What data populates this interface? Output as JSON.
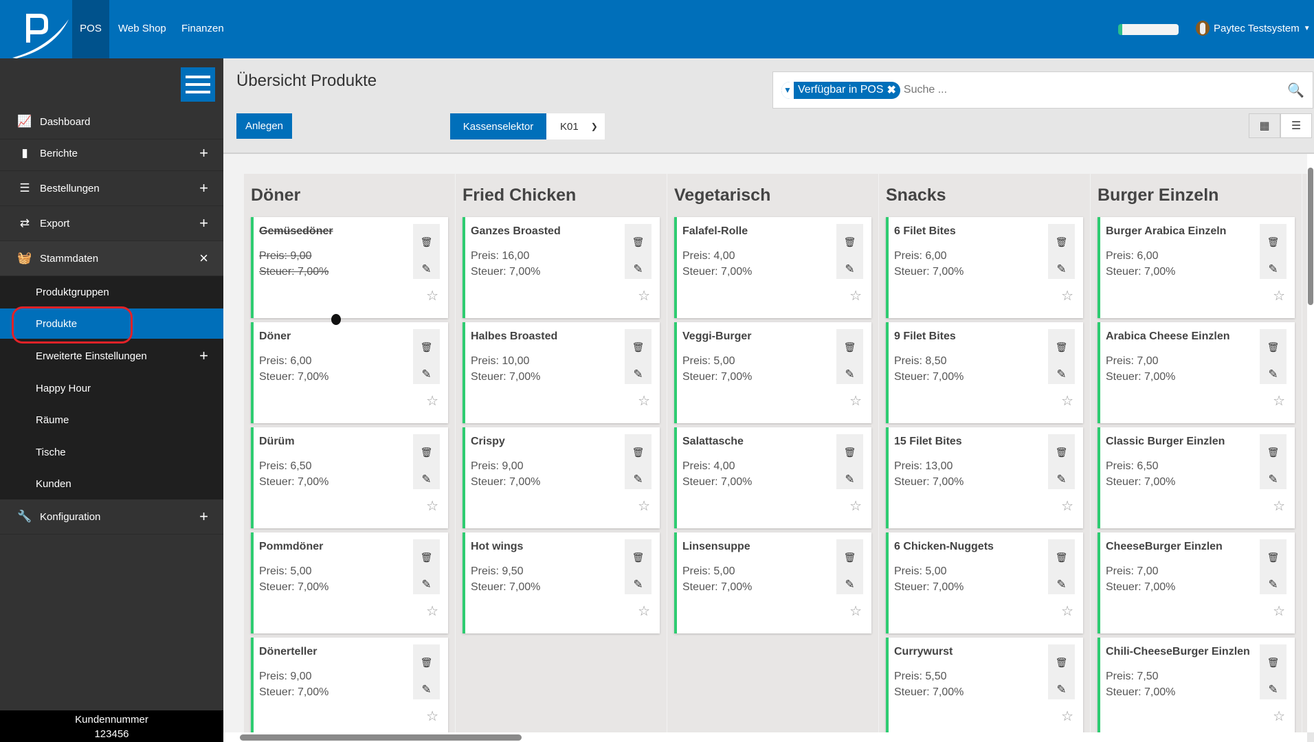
{
  "topbar": {
    "tabs": [
      {
        "label": "POS",
        "active": true
      },
      {
        "label": "Web Shop"
      },
      {
        "label": "Finanzen"
      }
    ],
    "user": "Paytec Testsystem",
    "accent": "#006fba"
  },
  "sidebar": {
    "items": [
      {
        "label": "Dashboard",
        "icon": "chart-line-icon"
      },
      {
        "label": "Berichte",
        "icon": "book-icon",
        "toggle": "+"
      },
      {
        "label": "Bestellungen",
        "icon": "list-icon",
        "toggle": "+"
      },
      {
        "label": "Export",
        "icon": "exchange-icon",
        "toggle": "+"
      },
      {
        "label": "Stammdaten",
        "icon": "basket-icon",
        "toggle": "×"
      }
    ],
    "subitems": [
      {
        "label": "Produktgruppen"
      },
      {
        "label": "Produkte",
        "active": true
      },
      {
        "label": "Erweiterte Einstellungen",
        "toggle": "+"
      },
      {
        "label": "Happy Hour"
      },
      {
        "label": "Räume"
      },
      {
        "label": "Tische"
      },
      {
        "label": "Kunden"
      }
    ],
    "config": {
      "label": "Konfiguration",
      "toggle": "+"
    },
    "footer_label": "Kundennummer",
    "footer_value": "123456"
  },
  "main": {
    "title": "Übersicht Produkte",
    "create_label": "Anlegen",
    "register_label": "Kassenselektor",
    "register_value": "K01",
    "filter_chip": "Verfügbar in POS",
    "search_placeholder": "Suche ...",
    "price_prefix": "Preis: ",
    "tax_prefix": "Steuer: ",
    "columns": [
      {
        "name": "Döner",
        "products": [
          {
            "name": "Gemüsedöner",
            "price": "9,00",
            "tax": "7,00%",
            "disabled": true
          },
          {
            "name": "Döner",
            "price": "6,00",
            "tax": "7,00%"
          },
          {
            "name": "Dürüm",
            "price": "6,50",
            "tax": "7,00%"
          },
          {
            "name": "Pommdöner",
            "price": "5,00",
            "tax": "7,00%"
          },
          {
            "name": "Dönerteller",
            "price": "9,00",
            "tax": "7,00%"
          }
        ]
      },
      {
        "name": "Fried Chicken",
        "products": [
          {
            "name": "Ganzes Broasted",
            "price": "16,00",
            "tax": "7,00%"
          },
          {
            "name": "Halbes Broasted",
            "price": "10,00",
            "tax": "7,00%"
          },
          {
            "name": "Crispy",
            "price": "9,00",
            "tax": "7,00%"
          },
          {
            "name": "Hot wings",
            "price": "9,50",
            "tax": "7,00%"
          }
        ]
      },
      {
        "name": "Vegetarisch",
        "products": [
          {
            "name": "Falafel-Rolle",
            "price": "4,00",
            "tax": "7,00%"
          },
          {
            "name": "Veggi-Burger",
            "price": "5,00",
            "tax": "7,00%"
          },
          {
            "name": "Salattasche",
            "price": "4,00",
            "tax": "7,00%"
          },
          {
            "name": "Linsensuppe",
            "price": "5,00",
            "tax": "7,00%"
          }
        ]
      },
      {
        "name": "Snacks",
        "products": [
          {
            "name": "6 Filet Bites",
            "price": "6,00",
            "tax": "7,00%"
          },
          {
            "name": "9 Filet Bites",
            "price": "8,50",
            "tax": "7,00%"
          },
          {
            "name": "15 Filet Bites",
            "price": "13,00",
            "tax": "7,00%"
          },
          {
            "name": "6 Chicken-Nuggets",
            "price": "5,00",
            "tax": "7,00%"
          },
          {
            "name": "Currywurst",
            "price": "5,50",
            "tax": "7,00%"
          }
        ]
      },
      {
        "name": "Burger Einzeln",
        "products": [
          {
            "name": "Burger Arabica Einzeln",
            "price": "6,00",
            "tax": "7,00%"
          },
          {
            "name": "Arabica Cheese Einzlen",
            "price": "7,00",
            "tax": "7,00%"
          },
          {
            "name": "Classic Burger Einzlen",
            "price": "6,50",
            "tax": "7,00%"
          },
          {
            "name": "CheeseBurger Einzlen",
            "price": "7,00",
            "tax": "7,00%"
          },
          {
            "name": "Chili-CheeseBurger Einzlen",
            "price": "7,50",
            "tax": "7,00%"
          }
        ]
      }
    ]
  }
}
